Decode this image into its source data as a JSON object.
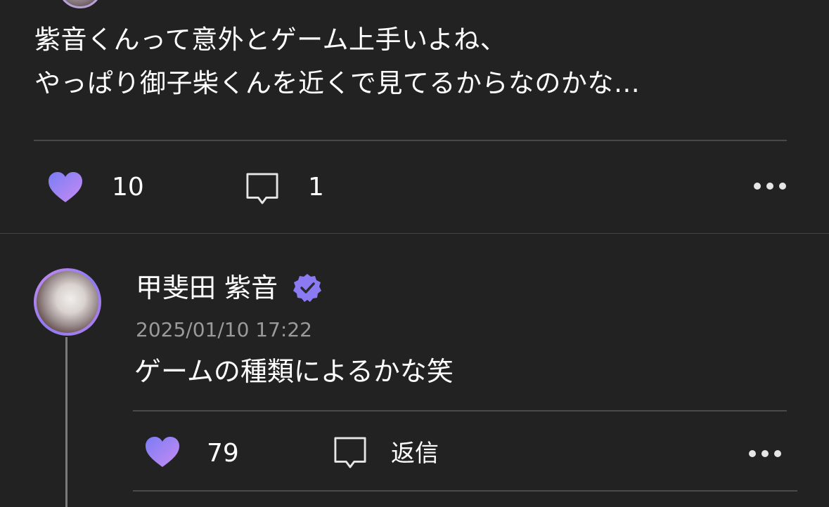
{
  "post": {
    "body_lines": [
      "紫音くんって意外とゲーム上手いよね、",
      "やっぱり御子柴くんを近くで見てるからなのかな…"
    ],
    "likes": "10",
    "comments": "1"
  },
  "reply": {
    "author": "甲斐田 紫音",
    "verified": true,
    "timestamp": "2025/01/10 17:22",
    "text": "ゲームの種類によるかな笑",
    "likes": "79",
    "reply_label": "返信"
  },
  "icons": {
    "like": "heart-icon",
    "comment": "comment-bubble-icon",
    "more": "more-dots-icon",
    "verified": "verified-badge-icon"
  },
  "colors": {
    "background": "#222222",
    "heart_gradient_start": "#7a7cf5",
    "heart_gradient_end": "#c88cf2",
    "verified_badge": "#8a7bf2",
    "timestamp": "#9a9a9a"
  }
}
